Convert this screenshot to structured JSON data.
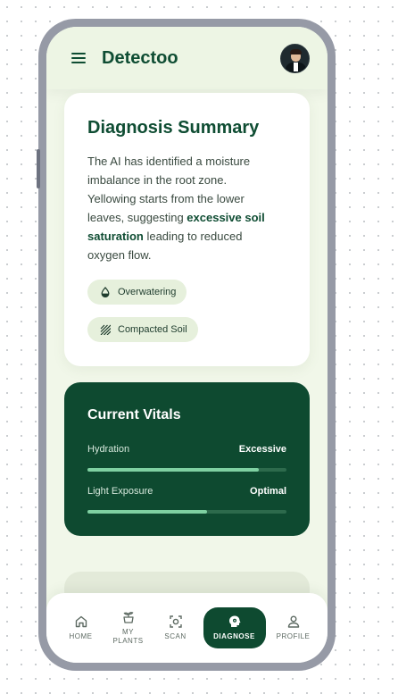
{
  "app": {
    "title": "Detectoo"
  },
  "icons": {
    "menu": "hamburger-menu-icon",
    "avatar": "user-avatar",
    "overwatering": "water-drop-icon",
    "compacted_soil": "diagonal-lines-icon",
    "home": "home-icon",
    "my_plants": "plant-pot-icon",
    "scan": "scan-frame-icon",
    "diagnose": "diagnose-head-icon",
    "profile": "person-icon"
  },
  "summary": {
    "title": "Diagnosis Summary",
    "body_pre": "The AI has identified a moisture imbalance in the root zone. Yellowing starts from the lower leaves, suggesting ",
    "body_strong": "excessive soil saturation",
    "body_post": " leading to reduced oxygen flow.",
    "tags": [
      {
        "label": "Overwatering"
      },
      {
        "label": "Compacted Soil"
      }
    ]
  },
  "vitals": {
    "title": "Current Vitals",
    "items": [
      {
        "label": "Hydration",
        "value": "Excessive",
        "level": 0.86
      },
      {
        "label": "Light Exposure",
        "value": "Optimal",
        "level": 0.6
      }
    ]
  },
  "nav": {
    "items": [
      {
        "label": "HOME"
      },
      {
        "label": "MY PLANTS"
      },
      {
        "label": "SCAN"
      },
      {
        "label": "DIAGNOSE"
      },
      {
        "label": "PROFILE"
      }
    ],
    "active": "DIAGNOSE"
  },
  "colors": {
    "brand": "#0f4d33",
    "background": "#f1f7e9",
    "vitals_card": "#0e4a30",
    "bar_fill": "#7fd1a2",
    "tag_bg": "#e6f0dc"
  }
}
